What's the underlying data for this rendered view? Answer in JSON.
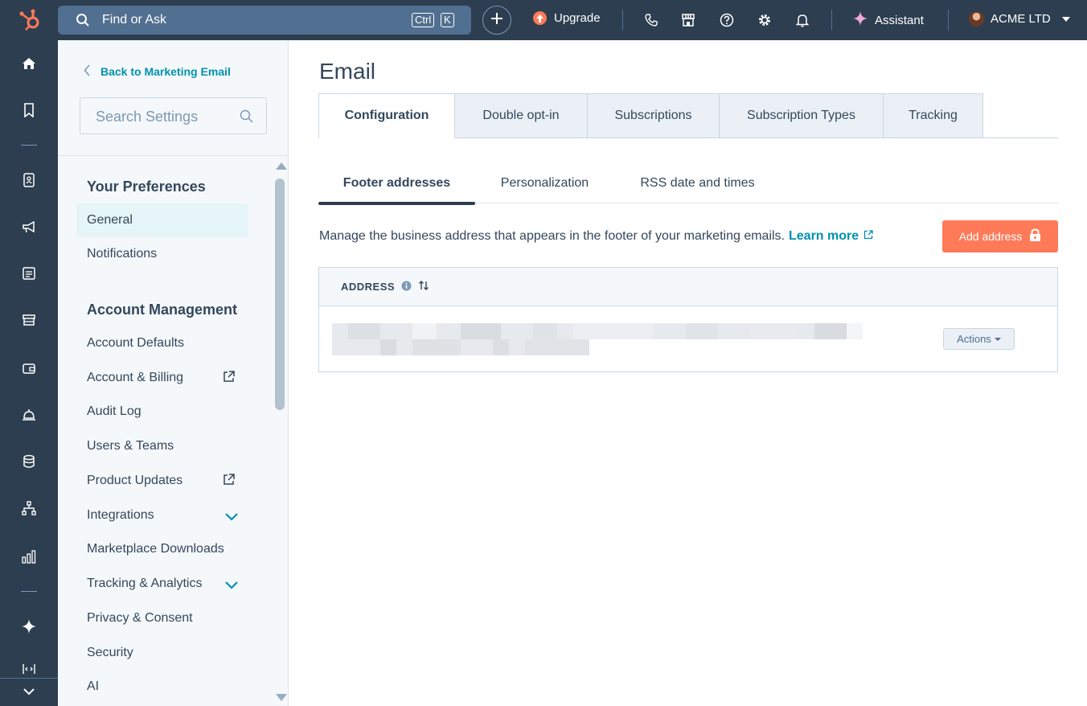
{
  "topbar": {
    "search_label": "Find or Ask",
    "shortcut_ctrl": "Ctrl",
    "shortcut_key": "K",
    "upgrade_label": "Upgrade",
    "assistant_label": "Assistant",
    "account_name": "ACME LTD",
    "icons": [
      "hubspot-logo-icon",
      "search-icon",
      "plus-icon",
      "upgrade-icon",
      "phone-icon",
      "marketplace-icon",
      "help-icon",
      "settings-icon",
      "notifications-icon",
      "sparkle-icon"
    ]
  },
  "rail": {
    "icons": [
      "home-icon",
      "bookmark-icon",
      "contacts-icon",
      "marketing-icon",
      "content-icon",
      "commerce-icon",
      "payments-icon",
      "service-icon",
      "data-icon",
      "automation-icon",
      "reporting-icon",
      "ai-icon",
      "developer-icon",
      "expand-icon"
    ]
  },
  "sidebar": {
    "back_label": "Back to Marketing Email",
    "search_placeholder": "Search Settings",
    "sections": [
      {
        "title": "Your Preferences",
        "items": [
          "General",
          "Notifications"
        ]
      },
      {
        "title": "Account Management",
        "items": [
          "Account Defaults",
          "Account & Billing",
          "Audit Log",
          "Users & Teams",
          "Product Updates",
          "Integrations",
          "Marketplace Downloads",
          "Tracking & Analytics",
          "Privacy & Consent",
          "Security",
          "AI"
        ]
      }
    ],
    "active_item": "General"
  },
  "main": {
    "title": "Email",
    "tabs": [
      "Configuration",
      "Double opt-in",
      "Subscriptions",
      "Subscription Types",
      "Tracking"
    ],
    "active_tab": "Configuration",
    "subtabs": [
      "Footer addresses",
      "Personalization",
      "RSS date and times"
    ],
    "active_subtab": "Footer addresses",
    "description": "Manage the business address that appears in the footer of your marketing emails.",
    "learn_more": "Learn more",
    "add_button": "Add address",
    "table": {
      "header": "ADDRESS",
      "actions_label": "Actions"
    }
  },
  "colors": {
    "nav_bg": "#2d3e50",
    "accent": "#ff7a59",
    "link": "#0091ae",
    "sidebar_bg": "#f5f8fa"
  }
}
